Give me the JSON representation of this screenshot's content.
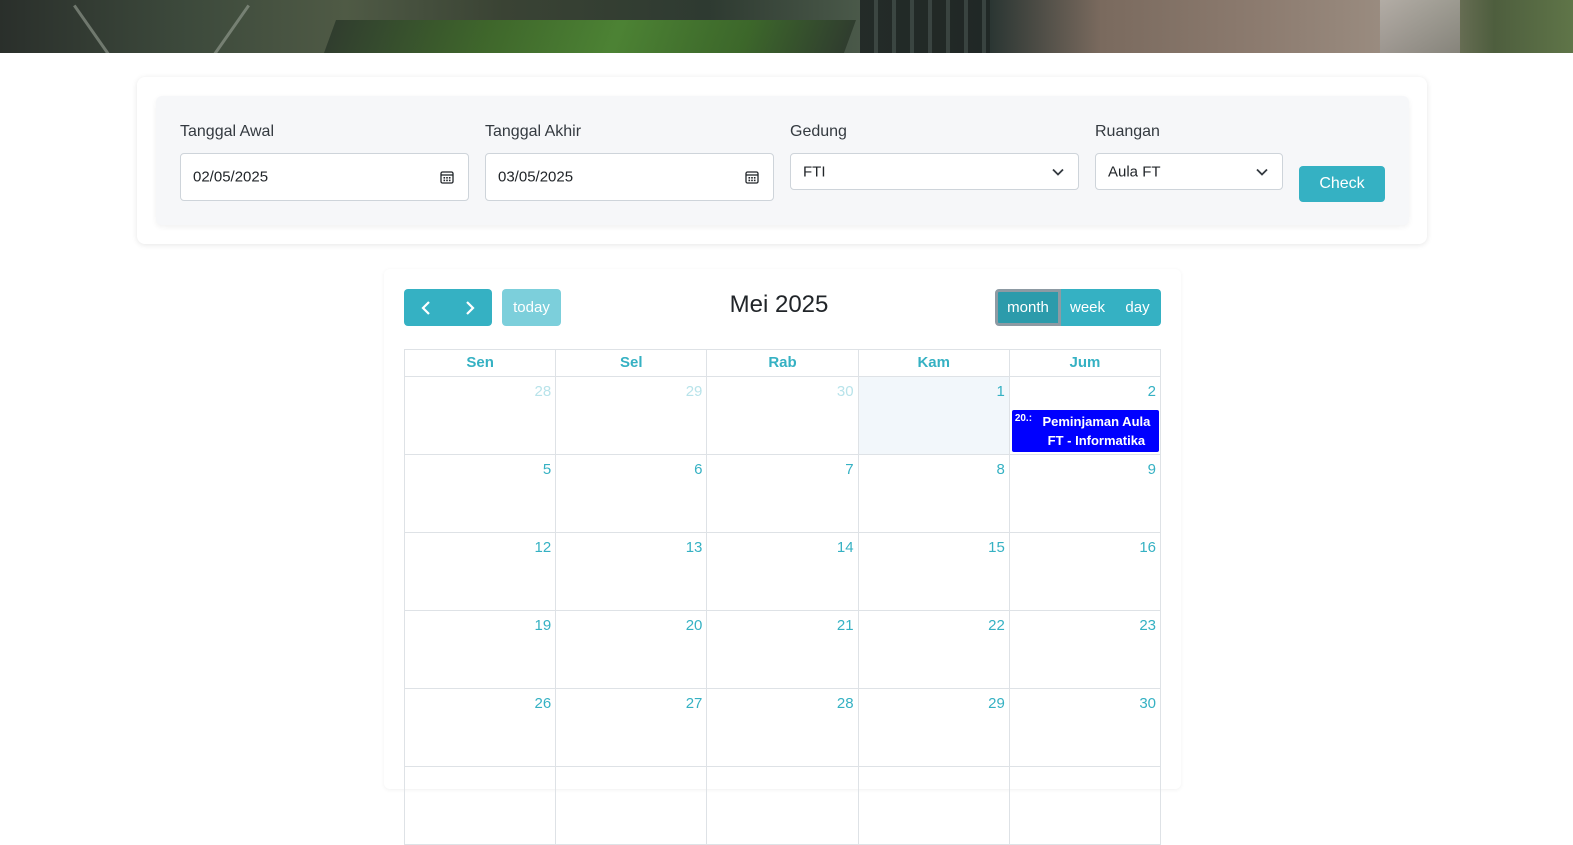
{
  "filter": {
    "start_date": {
      "label": "Tanggal Awal",
      "value": "02/05/2025"
    },
    "end_date": {
      "label": "Tanggal Akhir",
      "value": "03/05/2025"
    },
    "building": {
      "label": "Gedung",
      "value": "FTI"
    },
    "room": {
      "label": "Ruangan",
      "value": "Aula FT"
    },
    "check_label": "Check"
  },
  "calendar": {
    "title": "Mei 2025",
    "today_label": "today",
    "views": {
      "month": "month",
      "week": "week",
      "day": "day"
    },
    "active_view": "month",
    "day_headers": [
      "Sen",
      "Sel",
      "Rab",
      "Kam",
      "Jum"
    ],
    "weeks": [
      [
        "28",
        "29",
        "30",
        "1",
        "2"
      ],
      [
        "5",
        "6",
        "7",
        "8",
        "9"
      ],
      [
        "12",
        "13",
        "14",
        "15",
        "16"
      ],
      [
        "19",
        "20",
        "21",
        "22",
        "23"
      ],
      [
        "26",
        "27",
        "28",
        "29",
        "30"
      ]
    ],
    "event": {
      "time": "20.:",
      "title": "Peminjaman Aula FT - Informatika",
      "color": "#0000ff"
    }
  },
  "colors": {
    "accent": "#35b1c3",
    "today_bg": "#f2f7fb"
  }
}
